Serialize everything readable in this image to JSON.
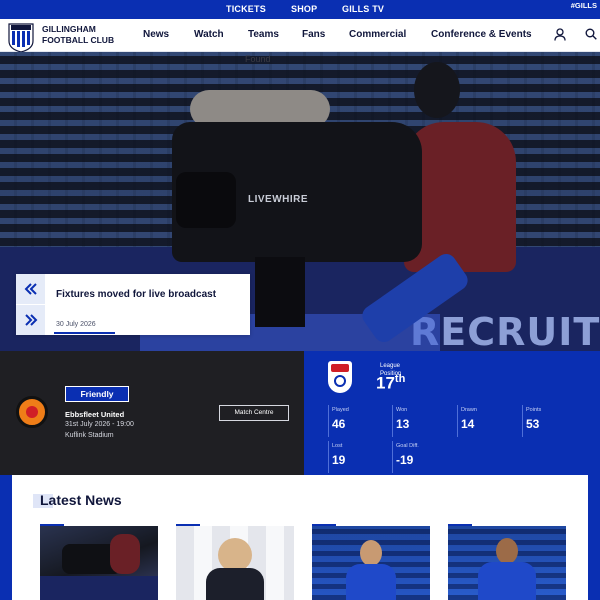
{
  "topbar": {
    "links": [
      "TICKETS",
      "SHOP",
      "GILLS TV"
    ],
    "hashtag": "#GILLS"
  },
  "header": {
    "club_name_line1": "GILLINGHAM",
    "club_name_line2": "FOOTBALL CLUB",
    "nav": [
      "News",
      "Watch",
      "Teams",
      "Fans",
      "Commercial",
      "Conference & Events"
    ],
    "icons": [
      "user-icon",
      "search-icon"
    ]
  },
  "hero": {
    "partial_text": "Found",
    "camera_brand": "LIVEWHIRE",
    "banner_text": "RECRUITING NO",
    "headline": "Fixtures moved for live broadcast",
    "date": "30 July 2026",
    "controls": [
      "previous-arrow",
      "next-arrow"
    ]
  },
  "fixture": {
    "competition": "Friendly",
    "opponent": "Ebbsfleet United",
    "datetime": "31st July 2026 - 19:00",
    "venue": "Kuflink Stadium",
    "match_centre_label": "Match Centre"
  },
  "league": {
    "position_label_line1": "League",
    "position_label_line2": "Position",
    "position_number": "17",
    "position_suffix": "th",
    "stats": [
      {
        "label": "Played",
        "value": "46"
      },
      {
        "label": "Won",
        "value": "13"
      },
      {
        "label": "Drawn",
        "value": "14"
      },
      {
        "label": "Points",
        "value": "53"
      },
      {
        "label": "Lost",
        "value": "19"
      },
      {
        "label": "Goal Diff.",
        "value": "-19"
      }
    ]
  },
  "news": {
    "title": "Latest News"
  },
  "colors": {
    "brand_blue": "#0a2fb2",
    "dark_panel": "#1f1f23",
    "text_dark": "#10163b"
  }
}
